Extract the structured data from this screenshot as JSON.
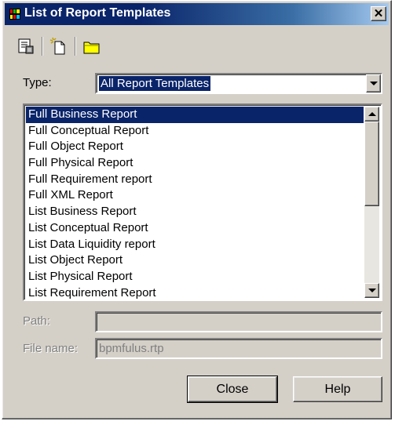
{
  "window": {
    "title": "List of Report Templates",
    "close_glyph": "✕"
  },
  "toolbar": {
    "buttons": [
      {
        "icon": "properties-icon"
      },
      {
        "icon": "new-icon"
      },
      {
        "icon": "folder-icon"
      }
    ]
  },
  "type": {
    "label": "Type:",
    "value": "All Report Templates"
  },
  "templates": [
    "Full Business Report",
    "Full Conceptual Report",
    "Full Object Report",
    "Full Physical Report",
    "Full Requirement report",
    "Full XML Report",
    "List Business Report",
    "List Conceptual Report",
    "List Data Liquidity report",
    "List Object Report",
    "List Physical Report",
    "List Requirement Report"
  ],
  "selected_index": 0,
  "path": {
    "label": "Path:",
    "value": ""
  },
  "file_name": {
    "label": "File name:",
    "value": "bpmfulus.rtp"
  },
  "buttons": {
    "close": "Close",
    "help": "Help"
  },
  "colors": {
    "selection": "#0a246a",
    "face": "#d4d0c8",
    "title_start": "#0a246a"
  }
}
